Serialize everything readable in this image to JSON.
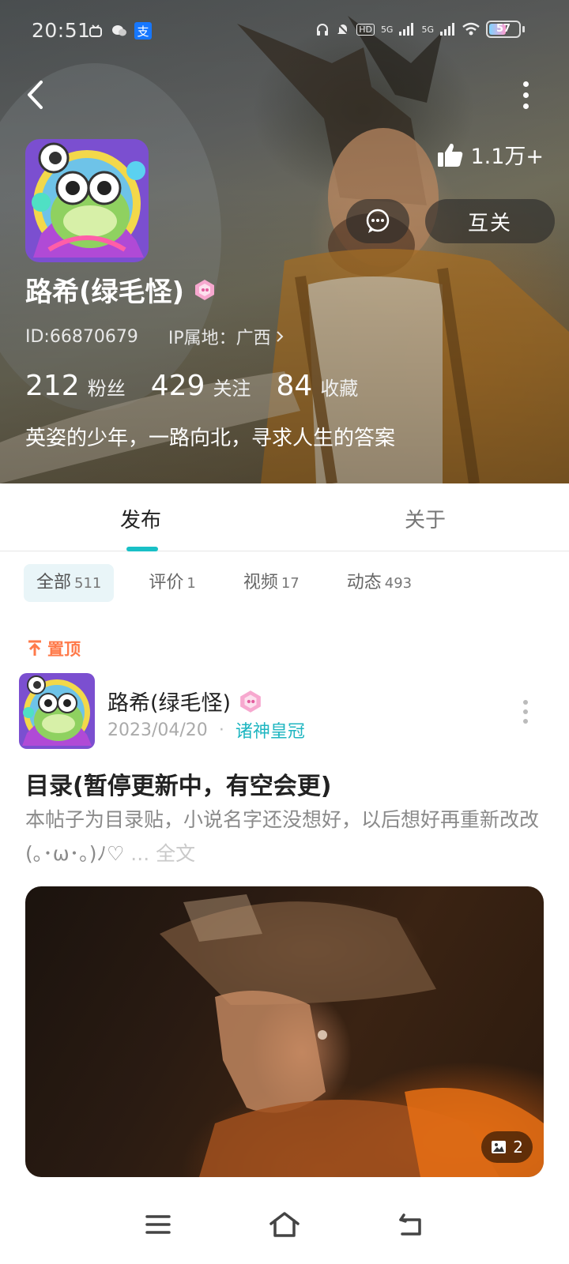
{
  "status_bar": {
    "time": "20:51",
    "battery": "57",
    "net1": "HD",
    "net2": "5G",
    "net3": "5G"
  },
  "profile": {
    "like_count": "1.1万+",
    "follow_button": "互关",
    "username": "路希(绿毛怪)",
    "id_text": "ID:66870679",
    "ip_text": "IP属地：广西",
    "stats": [
      {
        "num": "212",
        "label": "粉丝"
      },
      {
        "num": "429",
        "label": "关注"
      },
      {
        "num": "84",
        "label": "收藏"
      }
    ],
    "bio": "英姿的少年，一路向北，寻求人生的答案"
  },
  "tabs": [
    {
      "label": "发布"
    },
    {
      "label": "关于"
    }
  ],
  "filters": [
    {
      "label": "全部",
      "count": "511"
    },
    {
      "label": "评价",
      "count": "1"
    },
    {
      "label": "视频",
      "count": "17"
    },
    {
      "label": "动态",
      "count": "493"
    }
  ],
  "pinned_label": "置顶",
  "post": {
    "author": "路希(绿毛怪)",
    "date": "2023/04/20",
    "dot": "·",
    "crown": "诸神皇冠",
    "title": "目录(暂停更新中，有空会更)",
    "body": "本帖子为目录贴，小说名字还没想好，以后想好再重新改改(｡･ω･｡)ﾉ♡",
    "ellipsis": " ... ",
    "fulltext": "全文",
    "image_count": "2"
  },
  "colors": {
    "accent": "#19c0c6",
    "pinned": "#ff7a4a",
    "crown": "#1fb6c1"
  },
  "icons": {
    "back": "back-arrow-icon",
    "more": "more-vertical-icon",
    "like": "thumbs-up-icon",
    "message": "chat-bubble-icon",
    "pin": "pin-arrow-icon",
    "image": "image-icon",
    "menu": "menu-icon",
    "home": "home-icon",
    "back_nav": "return-icon"
  }
}
